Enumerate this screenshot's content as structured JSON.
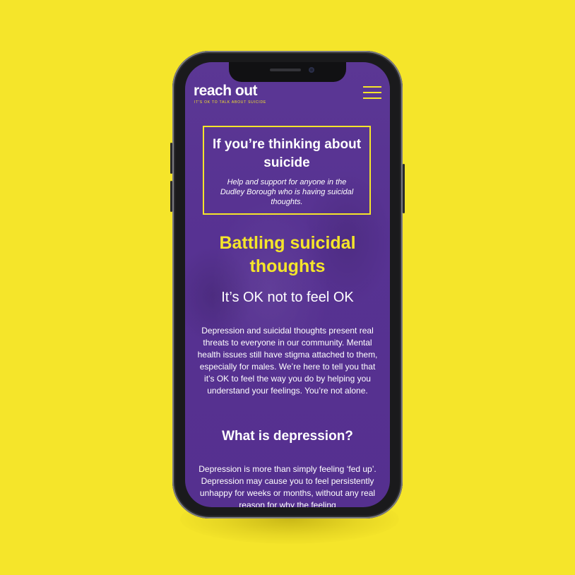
{
  "colors": {
    "background": "#f5e52a",
    "screen_purple": "#573292",
    "accent_yellow": "#f5e52a",
    "text_white": "#ffffff"
  },
  "header": {
    "logo": "reach out",
    "tagline": "IT'S OK TO TALK ABOUT SUICIDE",
    "menu_icon": "hamburger-menu-icon"
  },
  "intro": {
    "title": "If you’re thinking about suicide",
    "subtitle": "Help and support for anyone in the Dudley Borough who is having suicidal thoughts."
  },
  "hero": {
    "title": "Battling suicidal thoughts",
    "subtitle": "It’s OK not to feel OK"
  },
  "body": {
    "paragraph1": "Depression and suicidal thoughts present real threats to everyone in our community. Mental health issues still have stigma attached to them, especially for males. We’re here to tell you that it’s OK to feel the way you do by helping you understand your feelings. You’re not alone.",
    "section_title": "What is depression?",
    "paragraph2": "Depression is more than simply feeling ‘fed up’. Depression may cause you to feel persistently unhappy for weeks or months, without any real reason for why the feeling"
  }
}
